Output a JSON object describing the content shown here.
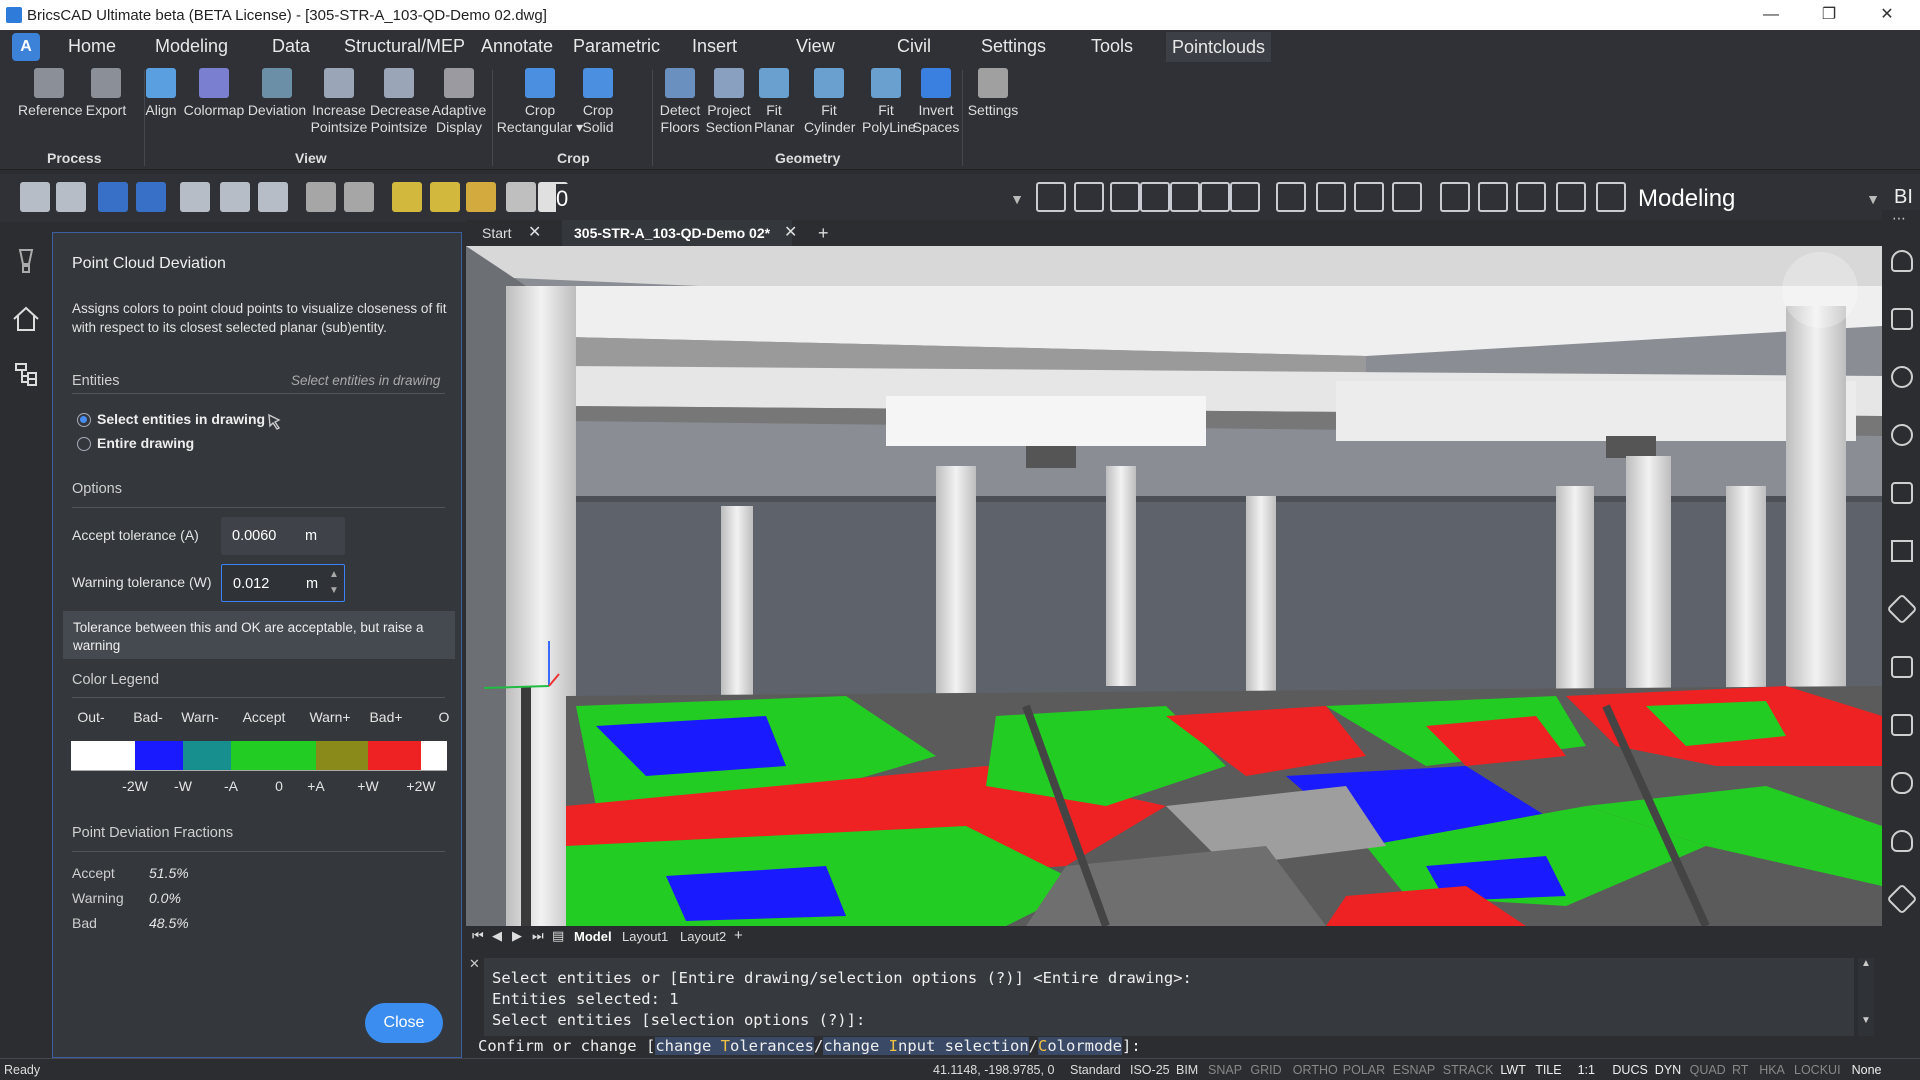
{
  "window": {
    "title": "BricsCAD Ultimate beta (BETA License) - [305-STR-A_103-QD-Demo 02.dwg]"
  },
  "menu": {
    "logo": "A",
    "items": [
      "Home",
      "Modeling",
      "Data",
      "Structural/MEP",
      "Annotate",
      "Parametric",
      "Insert",
      "View",
      "Civil",
      "Settings",
      "Tools",
      "Pointclouds"
    ],
    "active": "Pointclouds"
  },
  "ribbon": {
    "buttons": [
      {
        "label": "Reference",
        "icon": "reference-icon"
      },
      {
        "label": "Export",
        "icon": "export-icon"
      },
      {
        "label": "Align",
        "icon": "align-icon"
      },
      {
        "label": "Colormap",
        "icon": "colormap-icon"
      },
      {
        "label": "Deviation",
        "icon": "deviation-icon"
      },
      {
        "label": "Increase\nPointsize",
        "icon": "increase-pointsize-icon"
      },
      {
        "label": "Decrease\nPointsize",
        "icon": "decrease-pointsize-icon"
      },
      {
        "label": "Adaptive\nDisplay",
        "icon": "adaptive-display-icon"
      },
      {
        "label": "Crop\nRectangular ▾",
        "icon": "crop-rectangular-icon"
      },
      {
        "label": "Crop\nSolid",
        "icon": "crop-solid-icon"
      },
      {
        "label": "Detect\nFloors",
        "icon": "detect-floors-icon"
      },
      {
        "label": "Project\nSection",
        "icon": "project-section-icon"
      },
      {
        "label": "Fit\nPlanar",
        "icon": "fit-planar-icon"
      },
      {
        "label": "Fit\nCylinder",
        "icon": "fit-cylinder-icon"
      },
      {
        "label": "Fit\nPolyLine",
        "icon": "fit-polyline-icon"
      },
      {
        "label": "Invert\nSpaces",
        "icon": "invert-spaces-icon"
      },
      {
        "label": "Settings",
        "icon": "settings-icon"
      }
    ],
    "groups": [
      "Process",
      "View",
      "Crop",
      "Geometry"
    ]
  },
  "toolbar": {
    "current_layer": "0",
    "workspace": "Modeling",
    "overflow_label": "BI"
  },
  "panel": {
    "title": "Point Cloud Deviation",
    "description": "Assigns colors to point cloud points to visualize closeness of fit with respect to its closest selected planar (sub)entity.",
    "entities": {
      "label": "Entities",
      "hint": "Select entities in drawing",
      "options": [
        "Select entities in drawing",
        "Entire drawing"
      ],
      "selected": 0
    },
    "options_label": "Options",
    "accept": {
      "label": "Accept tolerance (A)",
      "value": "0.0060",
      "unit": "m"
    },
    "warning": {
      "label": "Warning tolerance (W)",
      "value": "0.012",
      "unit": "m"
    },
    "tooltip": "Tolerance between this and OK are acceptable, but raise a warning",
    "legend": {
      "label": "Color Legend",
      "headers": [
        "Out-",
        "Bad-",
        "Warn-",
        "Accept",
        "Warn+",
        "Bad+",
        "O"
      ],
      "footers": [
        "-2W",
        "-W",
        "-A",
        "0",
        "+A",
        "+W",
        "+2W"
      ],
      "colors": [
        "#ffffff",
        "#1a1aff",
        "#178f8f",
        "#22cc22",
        "#22cc22",
        "#8a8a1a",
        "#ee2222",
        "#ffffff"
      ]
    },
    "fractions": {
      "label": "Point Deviation Fractions",
      "rows": [
        {
          "label": "Accept",
          "value": "51.5%"
        },
        {
          "label": "Warning",
          "value": "0.0%"
        },
        {
          "label": "Bad",
          "value": "48.5%"
        }
      ]
    },
    "close_label": "Close"
  },
  "tabs": {
    "start": "Start",
    "doc": "305-STR-A_103-QD-Demo 02*",
    "add": "+"
  },
  "layouts": {
    "items": [
      "Model",
      "Layout1",
      "Layout2"
    ],
    "add": "+"
  },
  "command": {
    "log": [
      "Select entities or [Entire drawing/selection options (?)] <Entire drawing>:",
      "Entities selected: 1",
      "Select entities [selection options (?)]:"
    ],
    "prompt_prefix": "Confirm or change [",
    "opt1_a": "change ",
    "opt1_key": "T",
    "opt1_b": "olerances",
    "sep1": "/",
    "opt2_a": "change ",
    "opt2_key": "I",
    "opt2_b": "nput selection",
    "sep2": "/",
    "opt3_key": "C",
    "opt3_b": "olormode",
    "prompt_suffix": "]:"
  },
  "status": {
    "ready": "Ready",
    "coords": "41.1148, -198.9785, 0",
    "style": "Standard",
    "dimstyle": "ISO-25",
    "mode": "BIM",
    "toggles": [
      {
        "label": "SNAP",
        "on": false
      },
      {
        "label": "GRID",
        "on": false
      },
      {
        "label": "ORTHO",
        "on": false
      },
      {
        "label": "POLAR",
        "on": false
      },
      {
        "label": "ESNAP",
        "on": false
      },
      {
        "label": "STRACK",
        "on": false
      },
      {
        "label": "LWT",
        "on": true
      },
      {
        "label": "TILE",
        "on": true
      },
      {
        "label": "1:1",
        "on": true
      },
      {
        "label": "DUCS",
        "on": true
      },
      {
        "label": "DYN",
        "on": true
      },
      {
        "label": "QUAD",
        "on": false
      },
      {
        "label": "RT",
        "on": false
      },
      {
        "label": "HKA",
        "on": false
      },
      {
        "label": "LOCKUI",
        "on": false
      },
      {
        "label": "None",
        "on": true
      }
    ]
  }
}
